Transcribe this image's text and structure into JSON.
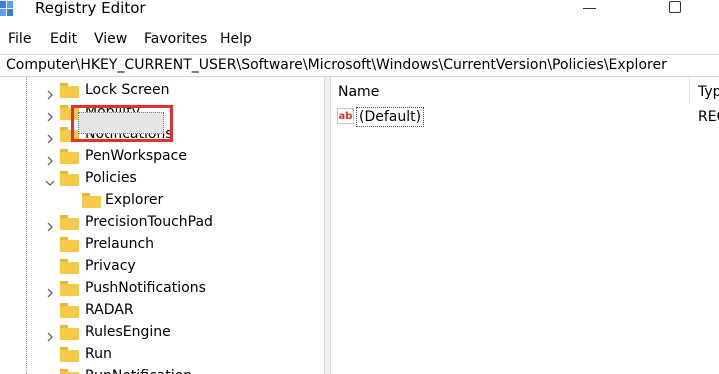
{
  "window": {
    "title": "Registry Editor"
  },
  "menu": [
    "File",
    "Edit",
    "View",
    "Favorites",
    "Help"
  ],
  "address": "Computer\\HKEY_CURRENT_USER\\Software\\Microsoft\\Windows\\CurrentVersion\\Policies\\Explorer",
  "tree": {
    "items": [
      {
        "label": "Lock Screen",
        "expander": "collapsed"
      },
      {
        "label": "Mobility",
        "expander": "collapsed"
      },
      {
        "label": "Notifications",
        "expander": "collapsed"
      },
      {
        "label": "PenWorkspace",
        "expander": "collapsed"
      },
      {
        "label": "Policies",
        "expander": "expanded"
      },
      {
        "label": "Explorer",
        "expander": "none",
        "selected": true
      },
      {
        "label": "PrecisionTouchPad",
        "expander": "collapsed"
      },
      {
        "label": "Prelaunch",
        "expander": "none"
      },
      {
        "label": "Privacy",
        "expander": "none"
      },
      {
        "label": "PushNotifications",
        "expander": "collapsed"
      },
      {
        "label": "RADAR",
        "expander": "none"
      },
      {
        "label": "RulesEngine",
        "expander": "collapsed"
      },
      {
        "label": "Run",
        "expander": "none"
      },
      {
        "label": "RunNotification",
        "expander": "none"
      }
    ]
  },
  "values": {
    "columns": [
      "Name",
      "Type"
    ],
    "rows": [
      {
        "name": "(Default)",
        "type": "REG_SZ"
      }
    ]
  },
  "colors": {
    "highlight": "#e03131",
    "folder": "#f7c948"
  }
}
